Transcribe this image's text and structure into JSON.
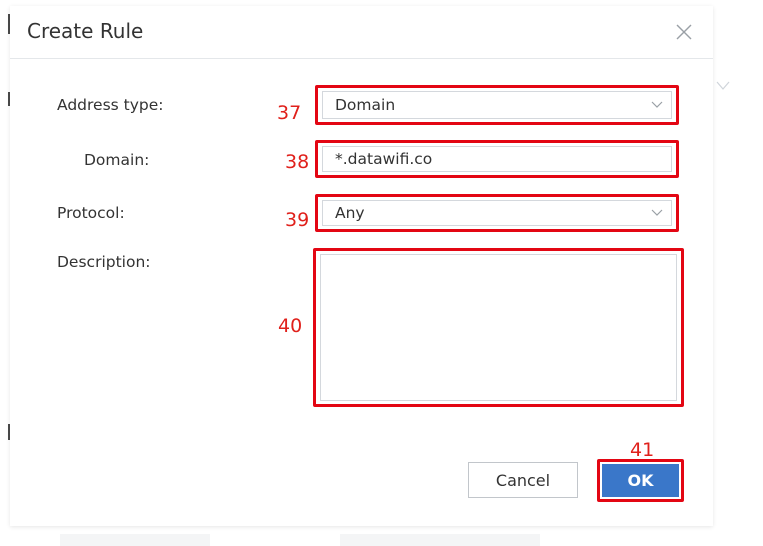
{
  "dialog": {
    "title": "Create Rule"
  },
  "form": {
    "address_type": {
      "label": "Address type:",
      "value": "Domain",
      "callout": "37"
    },
    "domain": {
      "label": "Domain:",
      "value": "*.datawifi.co",
      "callout": "38"
    },
    "protocol": {
      "label": "Protocol:",
      "value": "Any",
      "callout": "39"
    },
    "description": {
      "label": "Description:",
      "value": "",
      "callout": "40"
    }
  },
  "footer": {
    "cancel_label": "Cancel",
    "ok_label": "OK",
    "ok_callout": "41"
  },
  "colors": {
    "highlight_red": "#e30613",
    "callout_red": "#e0201b",
    "primary_blue": "#3a77c9"
  },
  "icons": {
    "close": "close-icon",
    "chevron": "chevron-down-icon"
  }
}
